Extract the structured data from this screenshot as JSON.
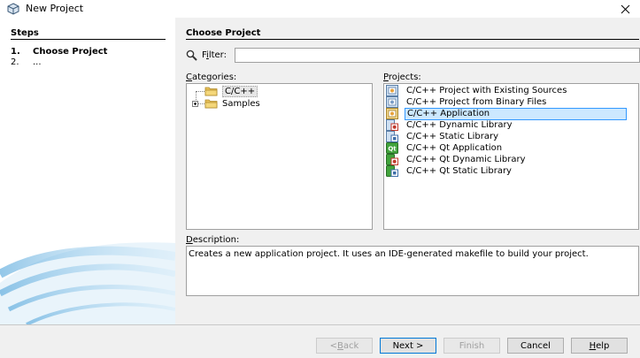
{
  "window": {
    "title": "New Project"
  },
  "steps": {
    "title": "Steps",
    "items": [
      {
        "number": "1.",
        "label": "Choose Project"
      },
      {
        "number": "2.",
        "label": "..."
      }
    ]
  },
  "main": {
    "title": "Choose Project",
    "filter": {
      "label_mnemonic": "i",
      "label_pre": "F",
      "label_post": "lter:",
      "value": ""
    },
    "categories": {
      "label_mnemonic": "C",
      "label_rest": "ategories:",
      "items": [
        {
          "label": "C/C++",
          "selected": true
        },
        {
          "label": "Samples",
          "selected": false
        }
      ]
    },
    "projects": {
      "label_mnemonic": "P",
      "label_rest": "rojects:",
      "items": [
        {
          "label": "C/C++ Project with Existing Sources",
          "icon": "project-sources-icon"
        },
        {
          "label": "C/C++ Project from Binary Files",
          "icon": "project-binary-icon"
        },
        {
          "label": "C/C++ Application",
          "icon": "application-icon",
          "selected": true
        },
        {
          "label": "C/C++ Dynamic Library",
          "icon": "dynamic-library-icon"
        },
        {
          "label": "C/C++ Static Library",
          "icon": "static-library-icon"
        },
        {
          "label": "C/C++ Qt Application",
          "icon": "qt-application-icon"
        },
        {
          "label": "C/C++ Qt Dynamic Library",
          "icon": "qt-dynamic-library-icon"
        },
        {
          "label": "C/C++ Qt Static Library",
          "icon": "qt-static-library-icon"
        }
      ]
    },
    "description": {
      "label_mnemonic": "D",
      "label_rest": "escription:",
      "text": "Creates a new application project. It uses an IDE-generated makefile to build your project."
    }
  },
  "buttons": {
    "back": {
      "pre": "< ",
      "mnemonic": "B",
      "post": "ack",
      "enabled": false
    },
    "next": {
      "pre": "Next >",
      "enabled": true
    },
    "finish": {
      "label": "Finish",
      "enabled": false
    },
    "cancel": {
      "label": "Cancel",
      "enabled": true
    },
    "help": {
      "mnemonic": "H",
      "post": "elp",
      "enabled": true
    }
  },
  "colors": {
    "selection_fill": "#cce8ff",
    "selection_border": "#3399ff",
    "default_button_border": "#0078d7",
    "steps_art": "#4aa3d8"
  }
}
